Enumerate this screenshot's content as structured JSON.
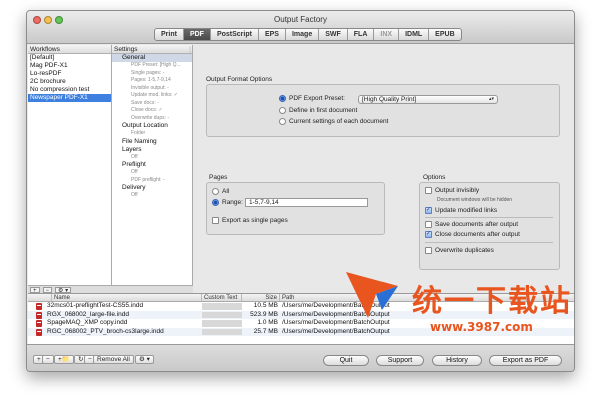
{
  "window": {
    "title": "Output Factory",
    "colors": {
      "accent": "#3d80df",
      "close": "#ee6b5f",
      "minimize": "#f5bf4f",
      "zoom": "#62c655"
    }
  },
  "tabs": [
    {
      "label": "Print"
    },
    {
      "label": "PDF"
    },
    {
      "label": "PostScript"
    },
    {
      "label": "EPS"
    },
    {
      "label": "Image"
    },
    {
      "label": "SWF"
    },
    {
      "label": "FLA"
    },
    {
      "label": "INX"
    },
    {
      "label": "IDML"
    },
    {
      "label": "EPUB"
    }
  ],
  "workflows": {
    "header": "Workflows",
    "items": [
      {
        "label": "[Default]"
      },
      {
        "label": "Mag PDF-X1"
      },
      {
        "label": "Lo-resPDF"
      },
      {
        "label": "2C brochure"
      },
      {
        "label": "No compression test"
      },
      {
        "label": "Newspaper PDF-X1"
      }
    ]
  },
  "settings": {
    "header": "Settings",
    "general": "General",
    "general_subs": [
      "PDF Preset: [High Q...",
      "Single pages: -",
      "Pages: 1-5,7-9,14",
      "Invisible output: -",
      "Update mod. links: ✓",
      "Save docs: -",
      "Close docs: ✓",
      "Overwrite dups: -"
    ],
    "output_location": "Output Location",
    "output_location_sub": "Folder",
    "file_naming": "File Naming",
    "layers": "Layers",
    "layers_sub": "Off",
    "preflight": "Preflight",
    "preflight_subs": [
      "Off",
      "PDF preflight: -"
    ],
    "delivery": "Delivery",
    "delivery_sub": "Off"
  },
  "main": {
    "output_format": {
      "title": "Output Format Options",
      "preset_label": "PDF Export Preset:",
      "preset_value": "[High Quality Print]",
      "define_label": "Define in first document",
      "current_label": "Current settings of each document"
    },
    "pages": {
      "title": "Pages",
      "all_label": "All",
      "range_label": "Range:",
      "range_value": "1-5,7-9,14",
      "single_label": "Export as single pages"
    },
    "options": {
      "title": "Options",
      "invisibly_label": "Output invisibly",
      "invisibly_note": "Document windows will be hidden",
      "update_label": "Update modified links",
      "save_label": "Save documents after output",
      "close_label": "Close documents after output",
      "overwrite_label": "Overwrite duplicates"
    }
  },
  "footers": {
    "add": "+",
    "remove": "−",
    "gear": "⚙ ▾"
  },
  "filelist": {
    "columns": {
      "name": "Name",
      "custom": "Custom Text",
      "size": "Size",
      "path": "Path"
    },
    "rows": [
      {
        "name": "32mcs01-preflightTest-CS55.indd",
        "custom": "",
        "size": "10.5 MB",
        "path": "/Users/me/Development/BatchOutput"
      },
      {
        "name": "RGX_068002_large-file.indd",
        "custom": "",
        "size": "523.9 MB",
        "path": "/Users/me/Development/BatchOutput"
      },
      {
        "name": "SpageMAQ_XMP copy.indd",
        "custom": "",
        "size": "1.0 MB",
        "path": "/Users/me/Development/BatchOutput"
      },
      {
        "name": "RGC_068002_PTV_broch-cs3large.indd",
        "custom": "",
        "size": "25.7 MB",
        "path": "/Users/me/Development/BatchOutput"
      }
    ]
  },
  "bottom": {
    "add_file": "+",
    "remove_file": "−",
    "add_folder": "+📁",
    "refresh": "↻",
    "remove_all": "Remove All",
    "gear": "⚙ ▾",
    "quit": "Quit",
    "support": "Support",
    "history": "History",
    "export": "Export as PDF"
  },
  "watermark": {
    "text": "统一下载站",
    "url": "www.3987.com",
    "color": "#e8551e"
  }
}
